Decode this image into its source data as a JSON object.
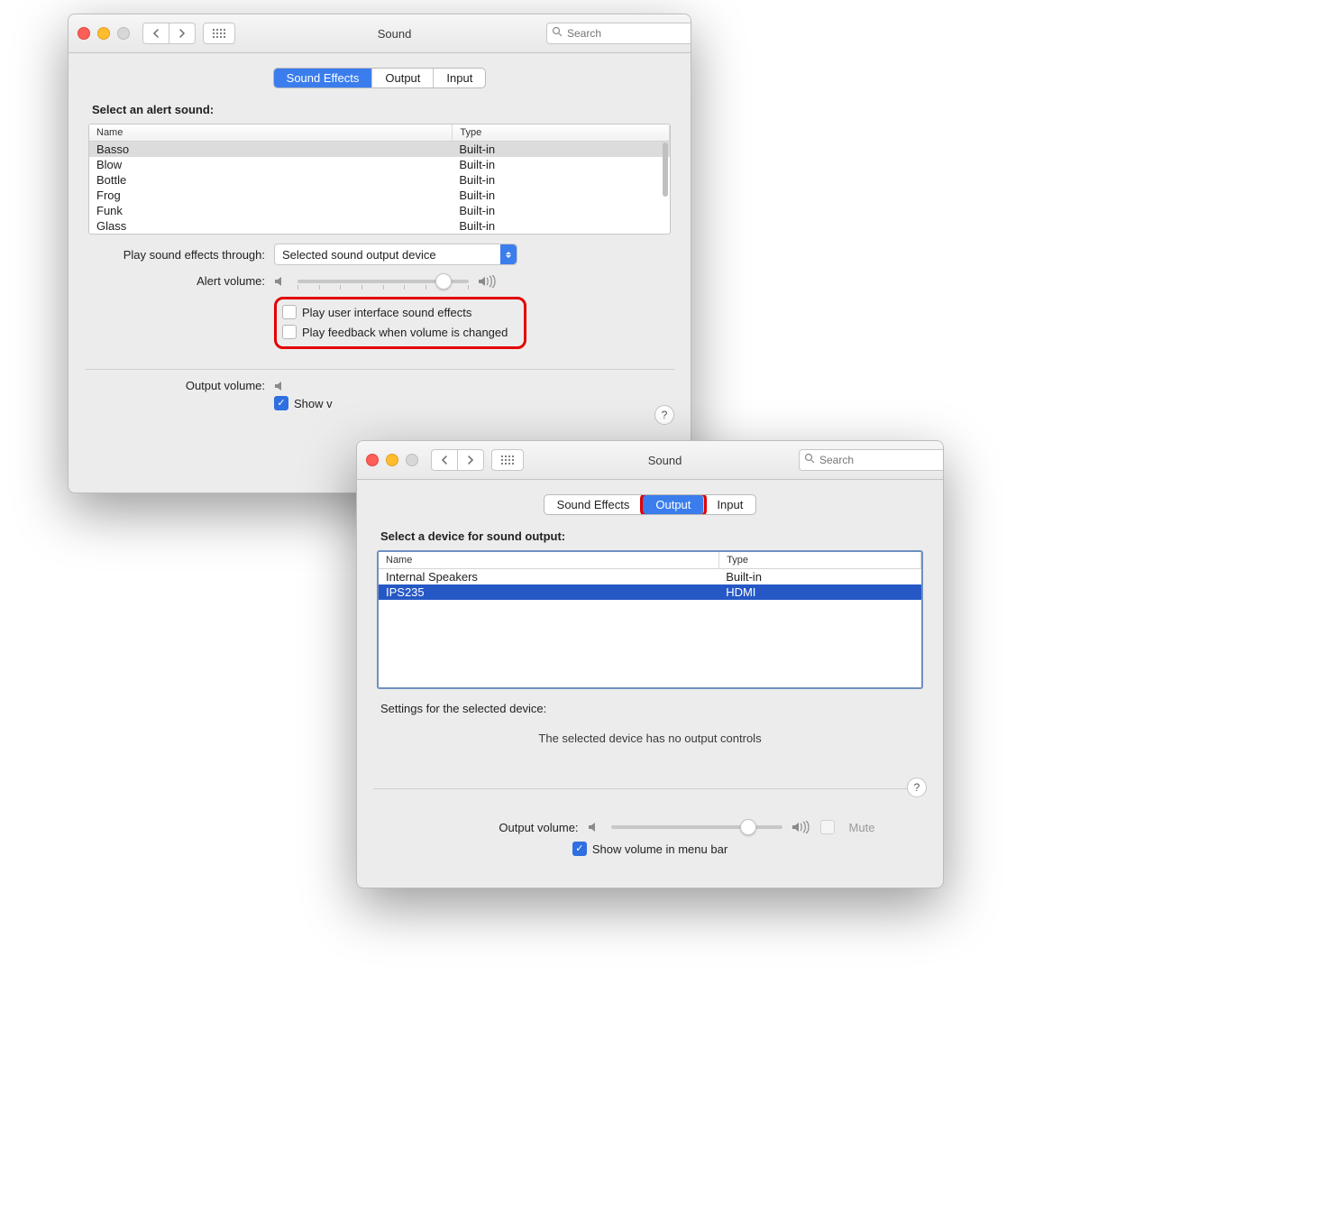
{
  "window1": {
    "title": "Sound",
    "search_placeholder": "Search",
    "tabs": {
      "sound_effects": "Sound Effects",
      "output": "Output",
      "input": "Input"
    },
    "heading": "Select an alert sound:",
    "columns": {
      "name": "Name",
      "type": "Type"
    },
    "sounds": [
      {
        "name": "Basso",
        "type": "Built-in",
        "selected": true
      },
      {
        "name": "Blow",
        "type": "Built-in"
      },
      {
        "name": "Bottle",
        "type": "Built-in"
      },
      {
        "name": "Frog",
        "type": "Built-in"
      },
      {
        "name": "Funk",
        "type": "Built-in"
      },
      {
        "name": "Glass",
        "type": "Built-in"
      }
    ],
    "play_through_label": "Play sound effects through:",
    "play_through_value": "Selected sound output device",
    "alert_volume_label": "Alert volume:",
    "alert_volume_percent": 85,
    "cb_ui_effects": "Play user interface sound effects",
    "cb_feedback": "Play feedback when volume is changed",
    "output_volume_label": "Output volume:",
    "show_volume_label": "Show v",
    "help": "?"
  },
  "window2": {
    "title": "Sound",
    "search_placeholder": "Search",
    "tabs": {
      "sound_effects": "Sound Effects",
      "output": "Output",
      "input": "Input"
    },
    "heading": "Select a device for sound output:",
    "columns": {
      "name": "Name",
      "type": "Type"
    },
    "devices": [
      {
        "name": "Internal Speakers",
        "type": "Built-in"
      },
      {
        "name": "IPS235",
        "type": "HDMI",
        "selected": true
      }
    ],
    "settings_label": "Settings for the selected device:",
    "no_controls": "The selected device has no output controls",
    "output_volume_label": "Output volume:",
    "output_volume_percent": 80,
    "mute_label": "Mute",
    "show_volume_label": "Show volume in menu bar",
    "help": "?"
  }
}
